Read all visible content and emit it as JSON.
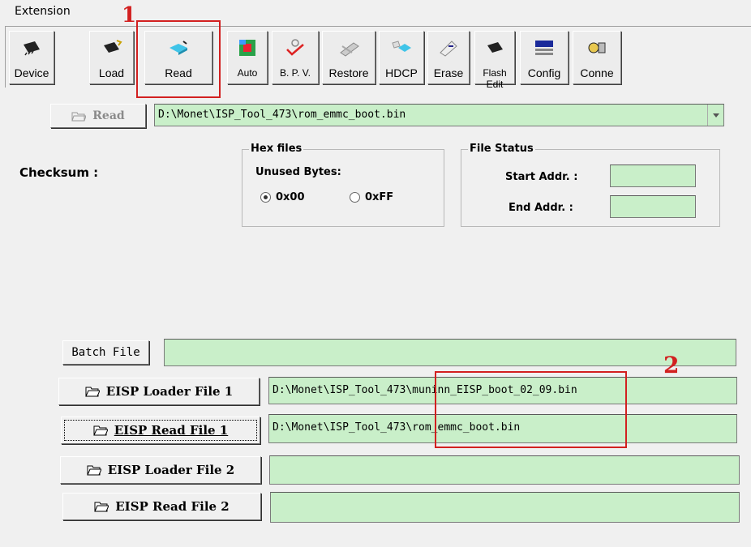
{
  "menu": {
    "extension": "Extension"
  },
  "toolbar": [
    {
      "label": "Device",
      "icon": "device-chip-icon"
    },
    {
      "label": "Load",
      "icon": "load-chip-icon"
    },
    {
      "label": "Read",
      "icon": "read-chip-icon"
    },
    {
      "label": "Auto",
      "icon": "auto-icon"
    },
    {
      "label": "B. P. V.",
      "icon": "bpv-check-icon"
    },
    {
      "label": "Restore",
      "icon": "restore-icon"
    },
    {
      "label": "HDCP",
      "icon": "hdcp-icon"
    },
    {
      "label": "Erase",
      "icon": "erase-icon"
    },
    {
      "label": "Flash Edit",
      "icon": "flash-edit-icon"
    },
    {
      "label": "Config",
      "icon": "config-icon"
    },
    {
      "label": "Conne",
      "icon": "connect-icon"
    }
  ],
  "read_panel": {
    "read_button": "Read",
    "path": "D:\\Monet\\ISP_Tool_473\\rom_emmc_boot.bin"
  },
  "checksum": {
    "label": "Checksum :"
  },
  "hex_files": {
    "title": "Hex files",
    "unused_bytes": "Unused Bytes:",
    "option_00": "0x00",
    "option_ff": "0xFF",
    "selected": "0x00"
  },
  "file_status": {
    "title": "File Status",
    "start_addr": "Start Addr. :",
    "end_addr": "End Addr. :",
    "start_value": "",
    "end_value": ""
  },
  "batch": {
    "label": "Batch File",
    "value": ""
  },
  "files": [
    {
      "label": "EISP Loader File 1",
      "path": "D:\\Monet\\ISP_Tool_473\\muninn_EISP_boot_02_09.bin"
    },
    {
      "label": "EISP Read File 1",
      "path": "D:\\Monet\\ISP_Tool_473\\rom_emmc_boot.bin"
    },
    {
      "label": "EISP Loader File 2",
      "path": ""
    },
    {
      "label": "EISP Read File 2",
      "path": ""
    }
  ],
  "annotations": {
    "one": "1",
    "two": "2"
  },
  "colors": {
    "field_green": "#c9efc9",
    "annotation_red": "#d22020"
  }
}
